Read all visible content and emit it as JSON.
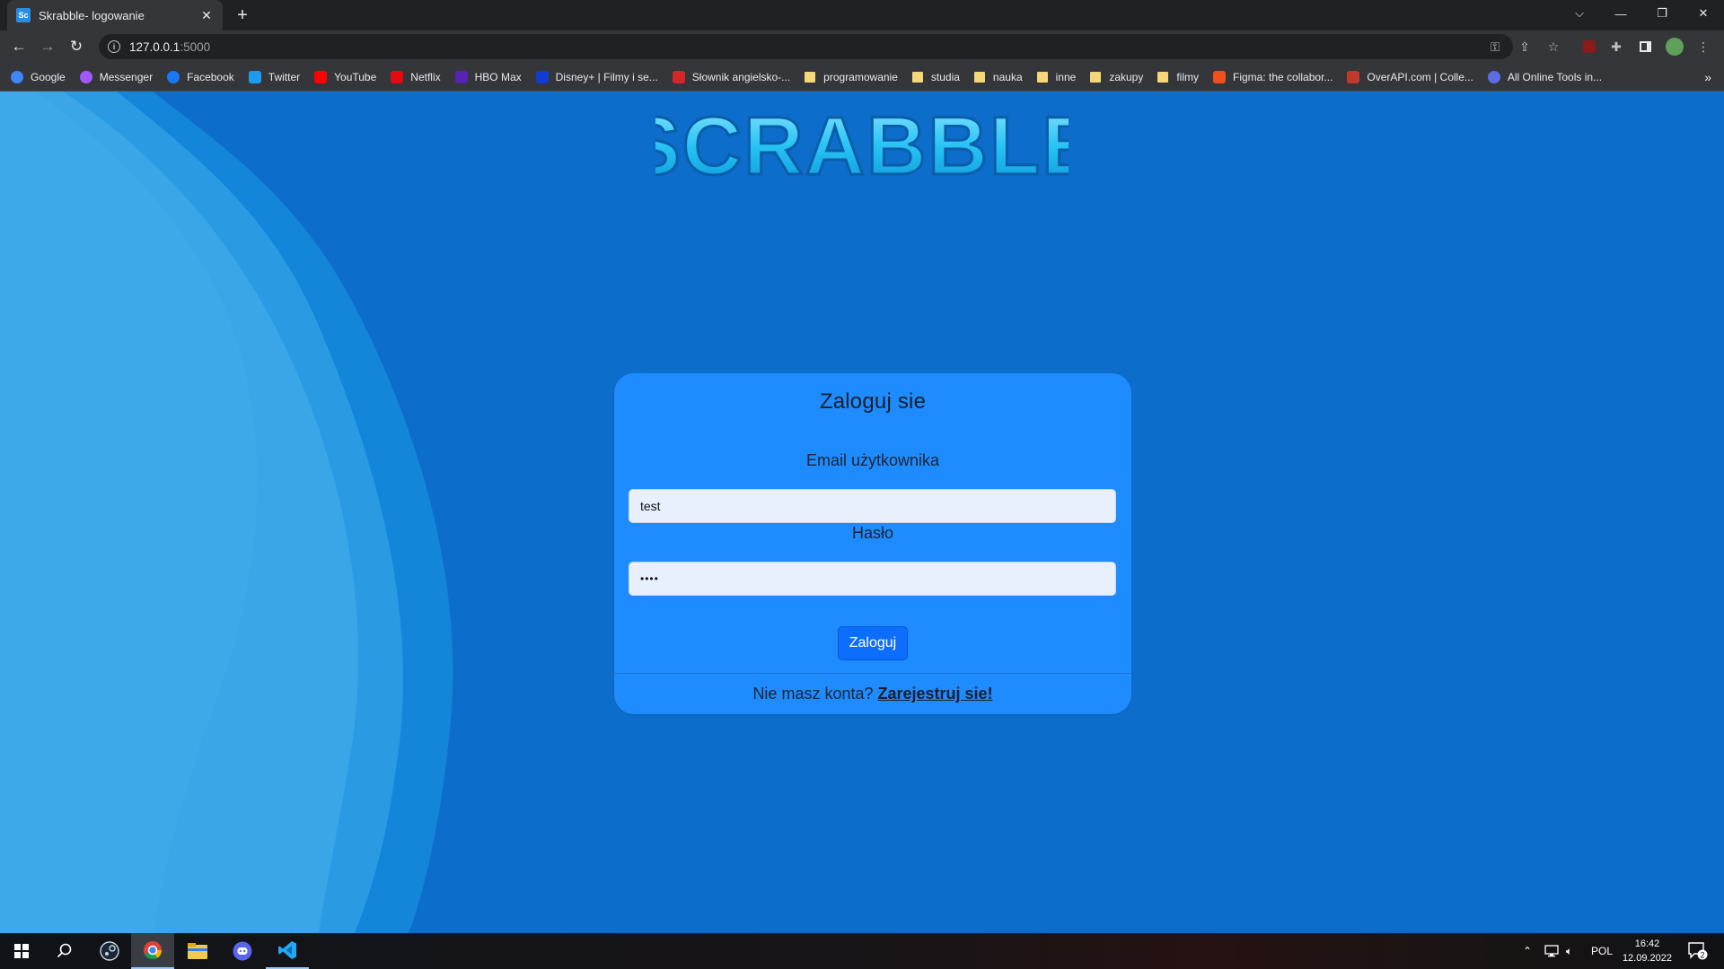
{
  "browser": {
    "tab_title": "Skrabble- logowanie",
    "tab_favicon_text": "Sc",
    "url_host": "127.0.0.1",
    "url_port": ":5000",
    "bookmarks": [
      {
        "label": "Google",
        "icon": "google-icon",
        "color": "#4285f4"
      },
      {
        "label": "Messenger",
        "icon": "messenger-icon",
        "color": "#a259ff"
      },
      {
        "label": "Facebook",
        "icon": "facebook-icon",
        "color": "#1877f2"
      },
      {
        "label": "Twitter",
        "icon": "twitter-icon",
        "color": "#1d9bf0"
      },
      {
        "label": "YouTube",
        "icon": "youtube-icon",
        "color": "#ff0000"
      },
      {
        "label": "Netflix",
        "icon": "netflix-icon",
        "color": "#e50914"
      },
      {
        "label": "HBO Max",
        "icon": "hbo-max-icon",
        "color": "#5822b4"
      },
      {
        "label": "Disney+ | Filmy i se...",
        "icon": "disney-plus-icon",
        "color": "#113ccf"
      },
      {
        "label": "Słownik angielsko-...",
        "icon": "diki-icon",
        "color": "#d6262a"
      },
      {
        "label": "programowanie",
        "icon": "folder-icon",
        "color": "#f6d67a"
      },
      {
        "label": "studia",
        "icon": "folder-icon",
        "color": "#f6d67a"
      },
      {
        "label": "nauka",
        "icon": "folder-icon",
        "color": "#f6d67a"
      },
      {
        "label": "inne",
        "icon": "folder-icon",
        "color": "#f6d67a"
      },
      {
        "label": "zakupy",
        "icon": "folder-icon",
        "color": "#f6d67a"
      },
      {
        "label": "filmy",
        "icon": "folder-icon",
        "color": "#f6d67a"
      },
      {
        "label": "Figma: the collabor...",
        "icon": "figma-icon",
        "color": "#f24e1e"
      },
      {
        "label": "OverAPI.com | Colle...",
        "icon": "overapi-icon",
        "color": "#c0392b"
      },
      {
        "label": "All Online Tools in...",
        "icon": "online-tools-icon",
        "color": "#5b6ee1"
      }
    ]
  },
  "page": {
    "logo_text": "SCRABBLE",
    "card": {
      "title": "Zaloguj sie",
      "email_label": "Email użytkownika",
      "email_value": "test",
      "password_label": "Hasło",
      "password_value": "••••",
      "submit_label": "Zaloguj",
      "footer_text": "Nie masz konta?",
      "register_link": "Zarejestruj sie!"
    }
  },
  "taskbar": {
    "language": "POL",
    "time": "16:42",
    "date": "12.09.2022",
    "notifications": "2"
  },
  "colors": {
    "page_bg": "#0d6dcb",
    "card_bg": "#1e8bff",
    "button_bg": "#0d6efd",
    "input_bg": "#e8f0fe"
  }
}
